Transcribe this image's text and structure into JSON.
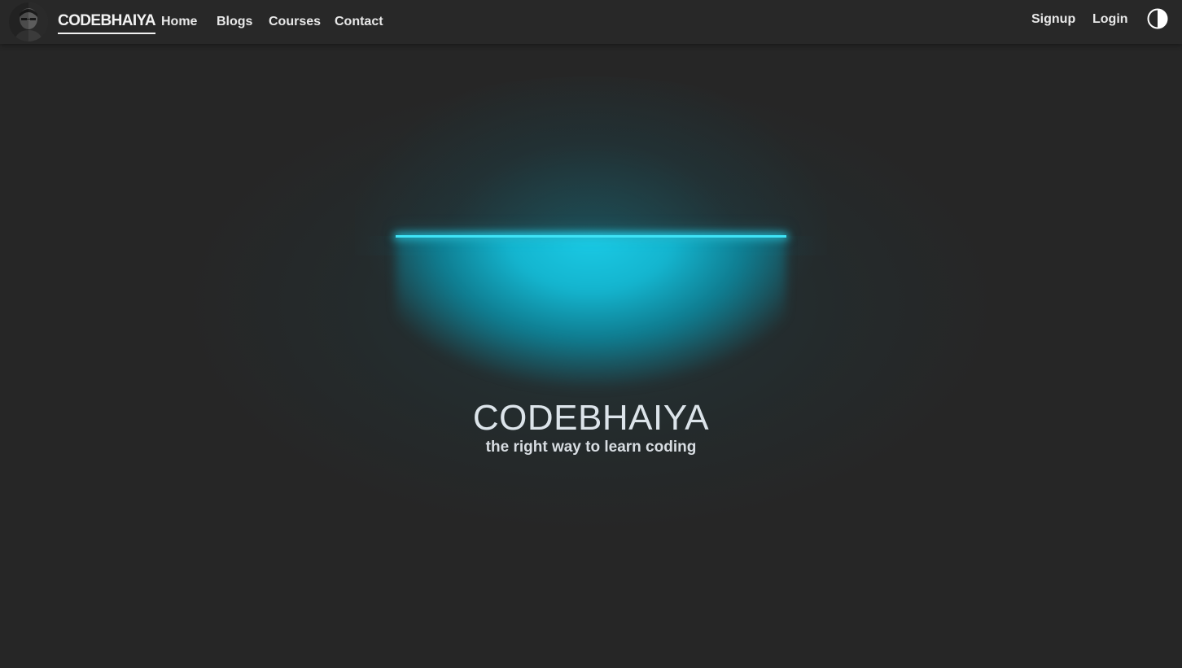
{
  "navbar": {
    "brand": "CODEBHAIYA",
    "links": [
      {
        "label": "Home"
      },
      {
        "label": "Blogs"
      },
      {
        "label": "Courses"
      },
      {
        "label": "Contact"
      }
    ],
    "auth": {
      "signup": "Signup",
      "login": "Login"
    },
    "icons": {
      "avatar": "profile-avatar",
      "theme": "contrast-icon"
    }
  },
  "hero": {
    "title": "CODEBHAIYA",
    "subtitle": "the right way to learn coding"
  },
  "colors": {
    "background": "#262626",
    "navbar": "#282828",
    "accent": "#1bcbe6",
    "text": "#e6e6e6"
  }
}
